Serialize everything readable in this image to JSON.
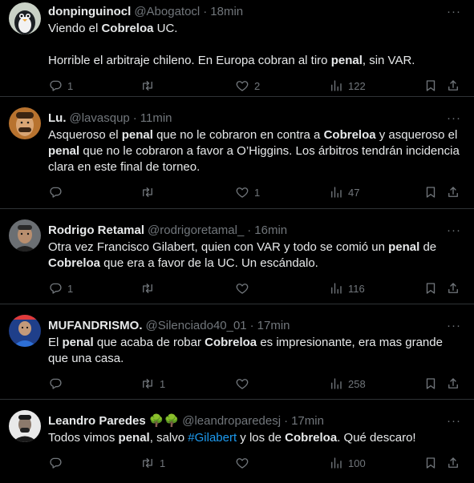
{
  "tweets": [
    {
      "name": "donpinguinocl",
      "handle": "@Abogatocl",
      "time": "18min",
      "text": [
        {
          "t": "Viendo el "
        },
        {
          "t": "Cobreloa",
          "b": true
        },
        {
          "t": " UC."
        },
        {
          "br": true
        },
        {
          "br": true
        },
        {
          "t": "Horrible el arbitraje chileno. En Europa cobran al tiro "
        },
        {
          "t": "penal",
          "b": true
        },
        {
          "t": ", sin VAR."
        }
      ],
      "replies": "1",
      "retweets": "",
      "likes": "2",
      "views": "122"
    },
    {
      "name": "Lu.",
      "handle": "@lavasqup",
      "time": "11min",
      "text": [
        {
          "t": "Asqueroso el "
        },
        {
          "t": "penal",
          "b": true
        },
        {
          "t": " que no le cobraron en contra a "
        },
        {
          "t": "Cobreloa",
          "b": true
        },
        {
          "t": " y asqueroso el "
        },
        {
          "t": "penal",
          "b": true
        },
        {
          "t": " que no le cobraron a favor a O’Higgins. Los árbitros tendrán incidencia clara en este final de torneo."
        }
      ],
      "replies": "",
      "retweets": "",
      "likes": "1",
      "views": "47"
    },
    {
      "name": "Rodrigo Retamal",
      "handle": "@rodrigoretamal_",
      "time": "16min",
      "text": [
        {
          "t": "Otra vez Francisco Gilabert, quien con VAR y todo se comió un "
        },
        {
          "t": "penal",
          "b": true
        },
        {
          "t": " de "
        },
        {
          "t": "Cobreloa",
          "b": true
        },
        {
          "t": " que era a favor de la UC. Un escándalo."
        }
      ],
      "replies": "1",
      "retweets": "",
      "likes": "",
      "views": "116"
    },
    {
      "name": "MUFANDRISMO.",
      "handle": "@Silenciado40_01",
      "time": "17min",
      "text": [
        {
          "t": "El "
        },
        {
          "t": "penal",
          "b": true
        },
        {
          "t": " que acaba de robar "
        },
        {
          "t": "Cobreloa",
          "b": true
        },
        {
          "t": " es impresionante, era mas grande que una casa."
        }
      ],
      "replies": "",
      "retweets": "1",
      "likes": "",
      "views": "258"
    },
    {
      "name": "Leandro Paredes 🌳🌳",
      "handle": "@leandroparedesj",
      "time": "17min",
      "text": [
        {
          "t": "Todos vimos "
        },
        {
          "t": "penal",
          "b": true
        },
        {
          "t": ", salvo "
        },
        {
          "t": "#Gilabert",
          "tag": true
        },
        {
          "t": " y los de "
        },
        {
          "t": "Cobreloa",
          "b": true
        },
        {
          "t": ". Qué descaro!"
        }
      ],
      "replies": "",
      "retweets": "1",
      "likes": "",
      "views": "100"
    }
  ],
  "ui": {
    "dot": "·",
    "more": "···"
  },
  "colors": {
    "background": "#000000",
    "text": "#e7e9ea",
    "muted": "#71767b",
    "link": "#1d9bf0",
    "divider": "#2f3336"
  },
  "icons": [
    "reply-icon",
    "retweet-icon",
    "like-icon",
    "views-icon",
    "bookmark-icon",
    "share-icon",
    "more-icon"
  ]
}
